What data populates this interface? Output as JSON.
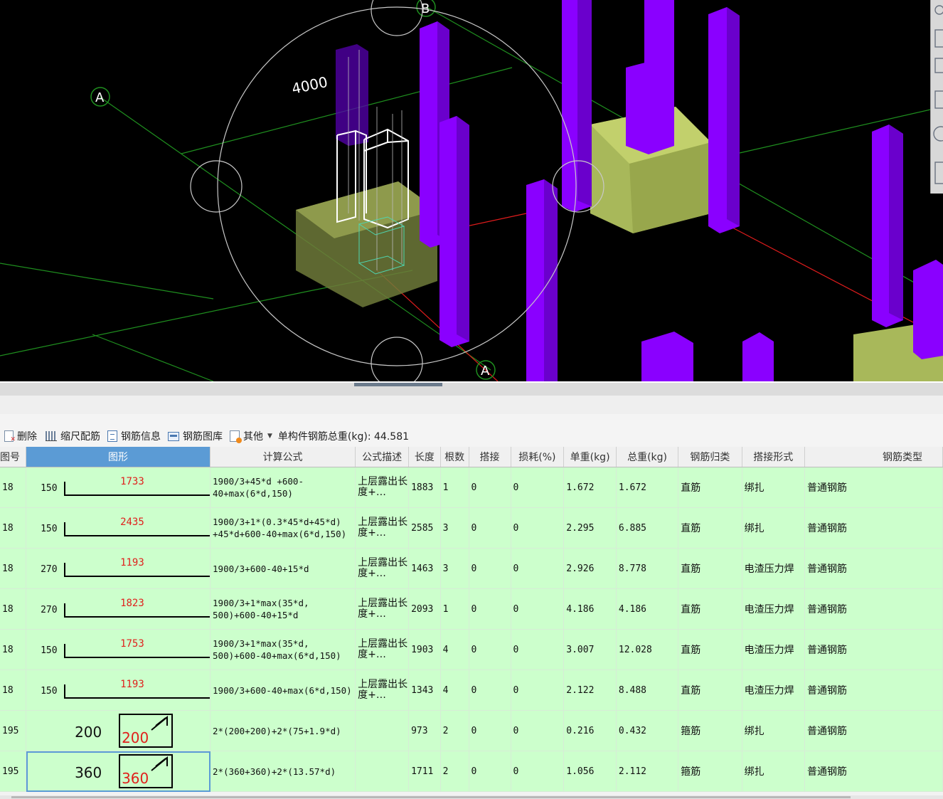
{
  "viewport": {
    "axis_labels": {
      "a_top": "A",
      "b_top": "B",
      "a_bottom": "A"
    },
    "dimension": "4000",
    "colors": {
      "background": "#000000",
      "column": "#8a00ff",
      "footing": "#a8b85a",
      "axis": "#1f8f1f",
      "red_axis": "#e01c1c"
    }
  },
  "side_panel": {
    "icons": [
      "zoom-icon",
      "view-icon",
      "cube-icon",
      "layer-icon",
      "orbit-icon",
      "panel-icon"
    ]
  },
  "toolbar": {
    "delete": "删除",
    "scale_rebar": "缩尺配筋",
    "rebar_info": "钢筋信息",
    "rebar_library": "钢筋图库",
    "other": "其他",
    "total_label": "单构件钢筋总重(kg):",
    "total_value": "44.581"
  },
  "table": {
    "headers": [
      "图号",
      "图形",
      "计算公式",
      "公式描述",
      "长度",
      "根数",
      "搭接",
      "损耗(%)",
      "单重(kg)",
      "总重(kg)",
      "钢筋归类",
      "搭接形式",
      "钢筋类型"
    ],
    "selected_header": "图形",
    "rows": [
      {
        "fig_no": "18",
        "shape": {
          "kind": "bar",
          "left": "150",
          "length": "1733"
        },
        "formula": "1900/3+45*d +600-40+max(6*d,150)",
        "desc": "上层露出长度+…",
        "length": "1883",
        "count": "1",
        "lap": "0",
        "loss": "0",
        "unit_wt": "1.672",
        "total_wt": "1.672",
        "category": "直筋",
        "lap_form": "绑扎",
        "rebar_type": "普通钢筋"
      },
      {
        "fig_no": "18",
        "shape": {
          "kind": "bar",
          "left": "150",
          "length": "2435"
        },
        "formula": "1900/3+1*(0.3*45*d+45*d) +45*d+600-40+max(6*d,150)",
        "desc": "上层露出长度+…",
        "length": "2585",
        "count": "3",
        "lap": "0",
        "loss": "0",
        "unit_wt": "2.295",
        "total_wt": "6.885",
        "category": "直筋",
        "lap_form": "绑扎",
        "rebar_type": "普通钢筋"
      },
      {
        "fig_no": "18",
        "shape": {
          "kind": "bar",
          "left": "270",
          "length": "1193"
        },
        "formula": "1900/3+600-40+15*d",
        "desc": "上层露出长度+…",
        "length": "1463",
        "count": "3",
        "lap": "0",
        "loss": "0",
        "unit_wt": "2.926",
        "total_wt": "8.778",
        "category": "直筋",
        "lap_form": "电渣压力焊",
        "rebar_type": "普通钢筋"
      },
      {
        "fig_no": "18",
        "shape": {
          "kind": "bar",
          "left": "270",
          "length": "1823"
        },
        "formula": "1900/3+1*max(35*d, 500)+600-40+15*d",
        "desc": "上层露出长度+…",
        "length": "2093",
        "count": "1",
        "lap": "0",
        "loss": "0",
        "unit_wt": "4.186",
        "total_wt": "4.186",
        "category": "直筋",
        "lap_form": "电渣压力焊",
        "rebar_type": "普通钢筋"
      },
      {
        "fig_no": "18",
        "shape": {
          "kind": "bar",
          "left": "150",
          "length": "1753"
        },
        "formula": "1900/3+1*max(35*d, 500)+600-40+max(6*d,150)",
        "desc": "上层露出长度+…",
        "length": "1903",
        "count": "4",
        "lap": "0",
        "loss": "0",
        "unit_wt": "3.007",
        "total_wt": "12.028",
        "category": "直筋",
        "lap_form": "电渣压力焊",
        "rebar_type": "普通钢筋"
      },
      {
        "fig_no": "18",
        "shape": {
          "kind": "bar",
          "left": "150",
          "length": "1193"
        },
        "formula": "1900/3+600-40+max(6*d,150)",
        "desc": "上层露出长度+…",
        "length": "1343",
        "count": "4",
        "lap": "0",
        "loss": "0",
        "unit_wt": "2.122",
        "total_wt": "8.488",
        "category": "直筋",
        "lap_form": "电渣压力焊",
        "rebar_type": "普通钢筋"
      },
      {
        "fig_no": "195",
        "shape": {
          "kind": "stirrup",
          "left": "200",
          "length": "200"
        },
        "formula": "2*(200+200)+2*(75+1.9*d)",
        "desc": "",
        "length": "973",
        "count": "2",
        "lap": "0",
        "loss": "0",
        "unit_wt": "0.216",
        "total_wt": "0.432",
        "category": "箍筋",
        "lap_form": "绑扎",
        "rebar_type": "普通钢筋"
      },
      {
        "fig_no": "195",
        "shape": {
          "kind": "stirrup",
          "left": "360",
          "length": "360"
        },
        "formula": "2*(360+360)+2*(13.57*d)",
        "desc": "",
        "length": "1711",
        "count": "2",
        "lap": "0",
        "loss": "0",
        "unit_wt": "1.056",
        "total_wt": "2.112",
        "category": "箍筋",
        "lap_form": "绑扎",
        "rebar_type": "普通钢筋"
      }
    ]
  }
}
